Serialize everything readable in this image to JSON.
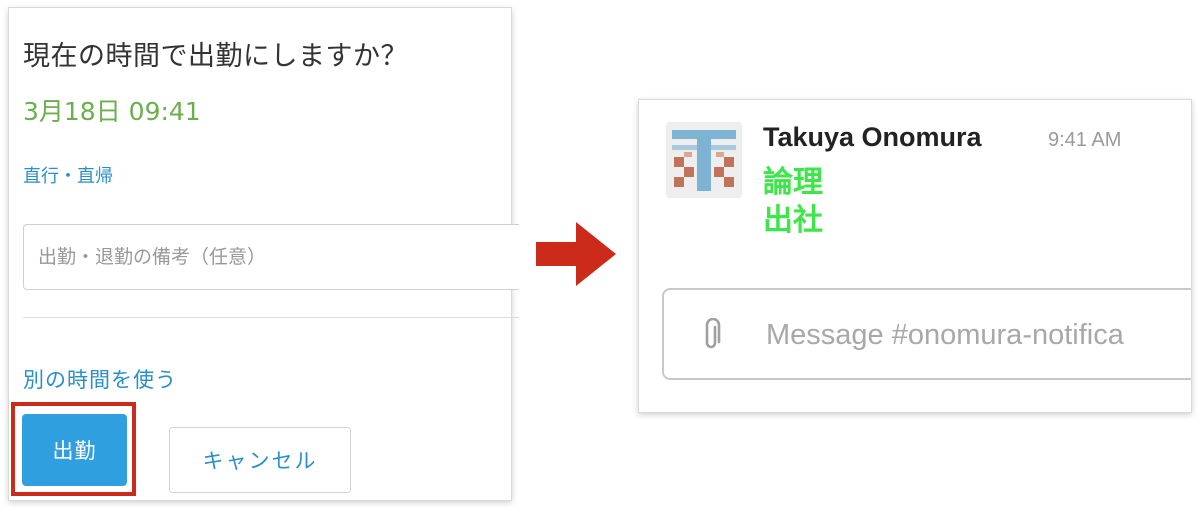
{
  "dialog": {
    "question": "現在の時間で出勤にしますか？",
    "datetime": "3月18日 09:41",
    "direct_link": "直行・直帰",
    "remarks_placeholder": "出勤・退勤の備考（任意）",
    "alt_time_link": "別の時間を使う",
    "clock_in_button": "出勤",
    "cancel_button": "キャンセル"
  },
  "slack": {
    "author": "Takuya Onomura",
    "time": "9:41 AM",
    "message_lines": [
      "論理",
      "出社"
    ],
    "composer_placeholder": "Message #onomura-notifica",
    "avatar_icon": "pixel-avatar-icon",
    "attach_icon": "paperclip-icon"
  },
  "colors": {
    "accent_blue": "#2f9fe0",
    "link_blue": "#2a8fc7",
    "datetime_green": "#6ab04c",
    "message_green": "#3ee64a",
    "highlight_red": "#cc2a1a"
  }
}
